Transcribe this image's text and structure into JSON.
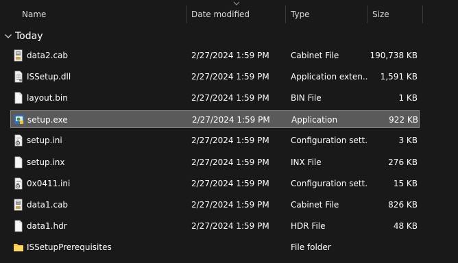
{
  "columns": {
    "name": "Name",
    "date": "Date modified",
    "type": "Type",
    "size": "Size"
  },
  "group": {
    "label": "Today"
  },
  "files": [
    {
      "name": "data2.cab",
      "date": "2/27/2024 1:59 PM",
      "type": "Cabinet File",
      "size": "190,738 KB",
      "icon": "cabinet-file-icon"
    },
    {
      "name": "ISSetup.dll",
      "date": "2/27/2024 1:59 PM",
      "type": "Application exten...",
      "size": "1,591 KB",
      "icon": "dll-file-icon"
    },
    {
      "name": "layout.bin",
      "date": "2/27/2024 1:59 PM",
      "type": "BIN File",
      "size": "1 KB",
      "icon": "blank-file-icon"
    },
    {
      "name": "setup.exe",
      "date": "2/27/2024 1:59 PM",
      "type": "Application",
      "size": "922 KB",
      "icon": "installer-exe-icon",
      "selected": true
    },
    {
      "name": "setup.ini",
      "date": "2/27/2024 1:59 PM",
      "type": "Configuration sett...",
      "size": "3 KB",
      "icon": "config-file-icon"
    },
    {
      "name": "setup.inx",
      "date": "2/27/2024 1:59 PM",
      "type": "INX File",
      "size": "276 KB",
      "icon": "blank-file-icon"
    },
    {
      "name": "0x0411.ini",
      "date": "2/27/2024 1:59 PM",
      "type": "Configuration sett...",
      "size": "15 KB",
      "icon": "config-file-icon"
    },
    {
      "name": "data1.cab",
      "date": "2/27/2024 1:59 PM",
      "type": "Cabinet File",
      "size": "826 KB",
      "icon": "cabinet-file-icon"
    },
    {
      "name": "data1.hdr",
      "date": "2/27/2024 1:59 PM",
      "type": "HDR File",
      "size": "48 KB",
      "icon": "blank-file-icon"
    },
    {
      "name": "ISSetupPrerequisites",
      "date": "",
      "type": "File folder",
      "size": "",
      "icon": "folder-icon"
    }
  ],
  "colors": {
    "background": "#191919",
    "selected_row": "#5a5a5a",
    "folder": "#f4c542"
  }
}
